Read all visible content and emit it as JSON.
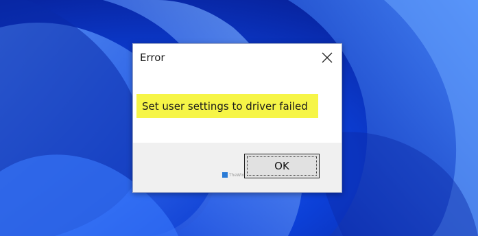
{
  "dialog": {
    "title": "Error",
    "message": "Set user settings to driver failed",
    "ok_label": "OK",
    "close_icon": "close-icon",
    "highlight_color": "#f6f547"
  },
  "watermark": {
    "text": "TheWindowsClub"
  },
  "colors": {
    "wallpaper_base": "#0b2fb8",
    "footer": "#f0f0f0"
  }
}
